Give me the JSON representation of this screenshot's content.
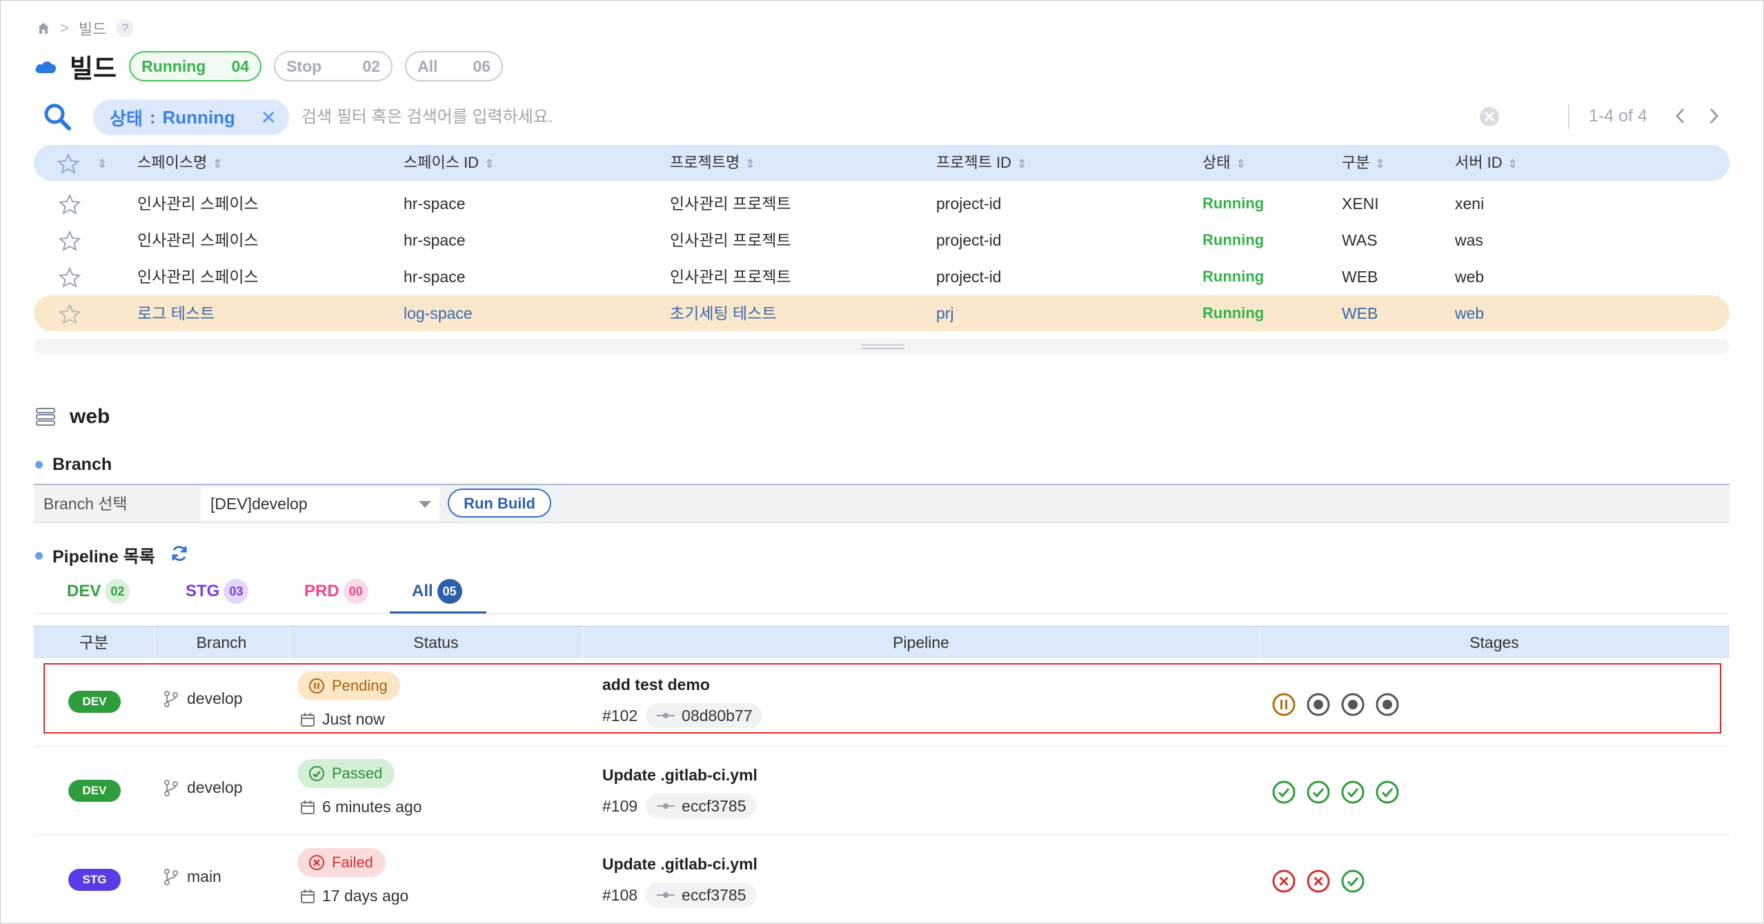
{
  "breadcrumb": {
    "current": "빌드",
    "help": "?"
  },
  "page": {
    "title": "빌드"
  },
  "filters": {
    "running": {
      "label": "Running",
      "count": "04"
    },
    "stop": {
      "label": "Stop",
      "count": "02"
    },
    "all": {
      "label": "All",
      "count": "06"
    }
  },
  "search": {
    "chip_key": "상태",
    "chip_sep": ":",
    "chip_value": "Running",
    "placeholder": "검색 필터 혹은 검색어를 입력하세요.",
    "value": ""
  },
  "pagination": {
    "info": "1-4 of 4"
  },
  "spaces_table": {
    "columns": [
      "스페이스명",
      "스페이스 ID",
      "프로젝트명",
      "프로젝트 ID",
      "상태",
      "구분",
      "서버 ID"
    ],
    "rows": [
      {
        "space_name": "인사관리 스페이스",
        "space_id": "hr-space",
        "project_name": "인사관리 프로젝트",
        "project_id": "project-id",
        "status": "Running",
        "type": "XENI",
        "server_id": "xeni"
      },
      {
        "space_name": "인사관리 스페이스",
        "space_id": "hr-space",
        "project_name": "인사관리 프로젝트",
        "project_id": "project-id",
        "status": "Running",
        "type": "WAS",
        "server_id": "was"
      },
      {
        "space_name": "인사관리 스페이스",
        "space_id": "hr-space",
        "project_name": "인사관리 프로젝트",
        "project_id": "project-id",
        "status": "Running",
        "type": "WEB",
        "server_id": "web"
      },
      {
        "space_name": "로그 테스트",
        "space_id": "log-space",
        "project_name": "초기세팅 테스트",
        "project_id": "prj",
        "status": "Running",
        "type": "WEB",
        "server_id": "web"
      }
    ]
  },
  "detail": {
    "server_title": "web",
    "branch_section": "Branch",
    "branch_select_label": "Branch 선택",
    "branch_selected": "[DEV]develop",
    "run_build_label": "Run Build",
    "pipeline_section": "Pipeline 목록"
  },
  "pipeline_tabs": [
    {
      "label": "DEV",
      "count": "02"
    },
    {
      "label": "STG",
      "count": "03"
    },
    {
      "label": "PRD",
      "count": "00"
    },
    {
      "label": "All",
      "count": "05"
    }
  ],
  "pipelines_table": {
    "columns": [
      "구분",
      "Branch",
      "Status",
      "Pipeline",
      "Stages"
    ],
    "rows": [
      {
        "env": "DEV",
        "branch": "develop",
        "status": "Pending",
        "time": "Just now",
        "title": "add test demo",
        "number": "#102",
        "sha": "08d80b77",
        "stages": [
          "pending",
          "queued",
          "queued",
          "queued"
        ]
      },
      {
        "env": "DEV",
        "branch": "develop",
        "status": "Passed",
        "time": "6 minutes ago",
        "title": "Update .gitlab-ci.yml",
        "number": "#109",
        "sha": "eccf3785",
        "stages": [
          "passed",
          "passed",
          "passed",
          "passed"
        ]
      },
      {
        "env": "STG",
        "branch": "main",
        "status": "Failed",
        "time": "17 days ago",
        "title": "Update .gitlab-ci.yml",
        "number": "#108",
        "sha": "eccf3785",
        "stages": [
          "failed",
          "failed",
          "passed"
        ]
      }
    ]
  },
  "colors": {
    "accent": "#3a82e8",
    "running": "#35b24a",
    "selected_row": "#f9e8cc",
    "highlight_border": "#e22b2b"
  }
}
